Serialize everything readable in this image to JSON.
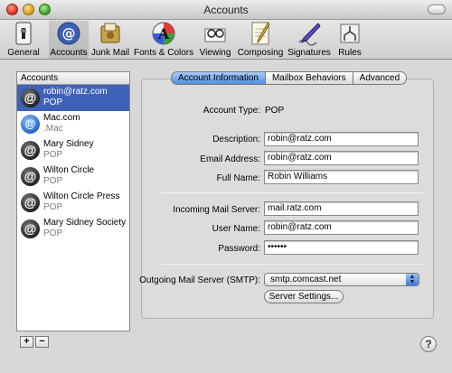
{
  "window": {
    "title": "Accounts"
  },
  "toolbar": {
    "items": [
      {
        "label": "General",
        "icon": "switch-icon"
      },
      {
        "label": "Accounts",
        "icon": "at-sign-icon",
        "selected": true
      },
      {
        "label": "Junk Mail",
        "icon": "junk-mail-icon"
      },
      {
        "label": "Fonts & Colors",
        "icon": "font-palette-icon"
      },
      {
        "label": "Viewing",
        "icon": "glasses-icon"
      },
      {
        "label": "Composing",
        "icon": "pencil-notepad-icon"
      },
      {
        "label": "Signatures",
        "icon": "signature-pen-icon"
      },
      {
        "label": "Rules",
        "icon": "rules-icon"
      }
    ]
  },
  "accounts": {
    "header": "Accounts",
    "items": [
      {
        "name": "robin@ratz.com",
        "type": "POP",
        "selected": true
      },
      {
        "name": "Mac.com",
        "type": ".Mac"
      },
      {
        "name": "Mary Sidney",
        "type": "POP"
      },
      {
        "name": "Wilton Circle",
        "type": "POP"
      },
      {
        "name": "Wilton Circle Press",
        "type": "POP"
      },
      {
        "name": "Mary Sidney Society",
        "type": "POP"
      }
    ],
    "add_label": "+",
    "remove_label": "−"
  },
  "tabs": [
    {
      "label": "Account Information",
      "active": true
    },
    {
      "label": "Mailbox Behaviors"
    },
    {
      "label": "Advanced"
    }
  ],
  "form": {
    "account_type_label": "Account Type:",
    "account_type_value": "POP",
    "description_label": "Description:",
    "description_value": "robin@ratz.com",
    "email_label": "Email Address:",
    "email_value": "robin@ratz.com",
    "fullname_label": "Full Name:",
    "fullname_value": "Robin Williams",
    "incoming_label": "Incoming Mail Server:",
    "incoming_value": "mail.ratz.com",
    "username_label": "User Name:",
    "username_value": "robin@ratz.com",
    "password_label": "Password:",
    "password_value": "••••••",
    "smtp_label": "Outgoing Mail Server (SMTP):",
    "smtp_value": "smtp.comcast.net",
    "server_settings_label": "Server Settings..."
  },
  "help_label": "?",
  "colors": {
    "selection": "#3d62b8",
    "active_tab": "#4f8fe0"
  }
}
